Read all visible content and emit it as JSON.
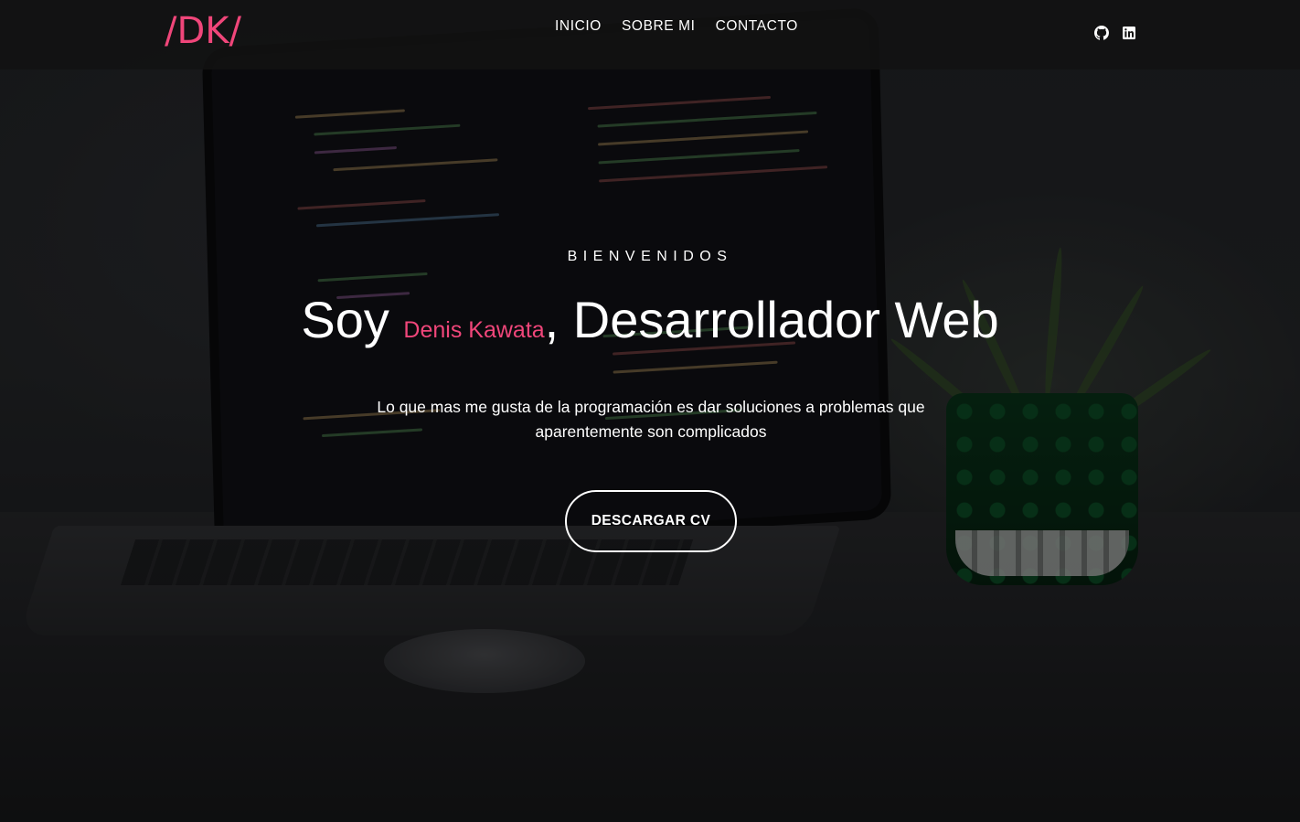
{
  "brand": {
    "logo_text": "/DK/",
    "accent_color": "#f0467a"
  },
  "nav": {
    "items": [
      {
        "label": "INICIO"
      },
      {
        "label": "SOBRE MI"
      },
      {
        "label": "CONTACTO"
      }
    ]
  },
  "social": {
    "icons": [
      "github-icon",
      "linkedin-icon"
    ]
  },
  "hero": {
    "welcome": "BIENVENIDOS",
    "headline_prefix": "Soy ",
    "name": "Denis Kawata",
    "headline_suffix": ", Desarrollador Web",
    "tagline": "Lo que mas me gusta de la programación es dar soluciones a problemas que aparentemente son complicados",
    "cta_label": "DESCARGAR CV"
  }
}
